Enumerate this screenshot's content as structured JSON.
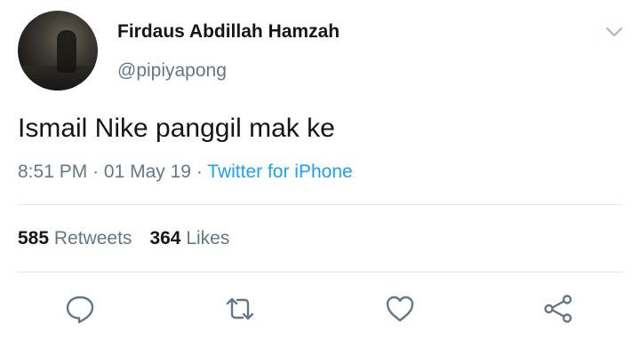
{
  "tweet": {
    "display_name": "Firdaus Abdillah Hamzah",
    "handle": "@pipiyapong",
    "text": "Ismail Nike panggil mak ke",
    "time": "8:51 PM",
    "date": "01 May 19",
    "separator": "·",
    "source": "Twitter for iPhone"
  },
  "stats": {
    "retweets_count": "585",
    "retweets_label": "Retweets",
    "likes_count": "364",
    "likes_label": "Likes"
  },
  "icons": {
    "menu": "chevron-down-icon",
    "reply": "reply-icon",
    "retweet": "retweet-icon",
    "like": "heart-icon",
    "share": "share-icon"
  },
  "colors": {
    "text": "#14171a",
    "secondary": "#657786",
    "link": "#1da1f2",
    "divider": "#e1e8ed"
  }
}
